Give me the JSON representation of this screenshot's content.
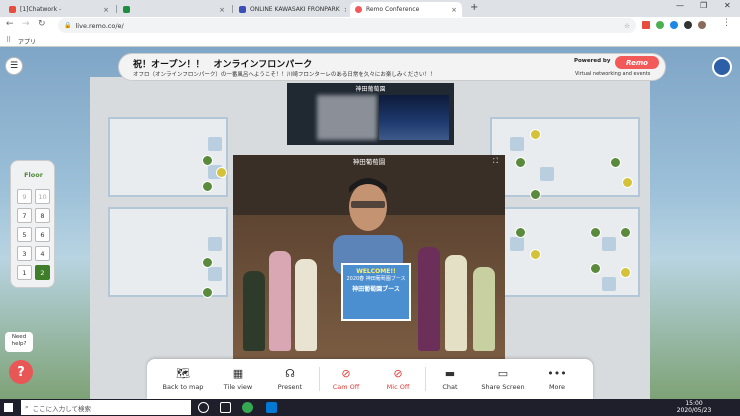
{
  "browser": {
    "tabs": [
      {
        "title": "[1]Chatwork -",
        "active": false,
        "color": "#e74c3c"
      },
      {
        "title": "",
        "active": false,
        "color": "#1e8e3e"
      },
      {
        "title": "ONLINE KAWASAKI FRONPARK",
        "active": false,
        "color": "#3b4fb8"
      },
      {
        "title": "Remo Conference",
        "active": true,
        "color": "#f25a5a"
      }
    ],
    "url": "live.remo.co/e/",
    "bookmarks_label": "アプリ"
  },
  "banner": {
    "title": "祝！オープン！！　オンラインフロンパーク",
    "subtitle": "オフロ（オンラインフロンパーク）の一番風呂へようこそ！！川崎フロンターレのある日常を久々にお楽しみください！！",
    "powered_by": "Powered by",
    "logo": "Remo",
    "tagline": "Virtual networking and events"
  },
  "floor": {
    "label": "Floor",
    "buttons": [
      "9",
      "10",
      "7",
      "8",
      "5",
      "6",
      "3",
      "4",
      "1",
      "2"
    ],
    "selected": "2"
  },
  "videos": {
    "small_label": "神田葡萄園",
    "main_label": "神田葡萄園",
    "sign_title": "WELCOME!!",
    "sign_line": "2020春 神田葡萄園ブース",
    "sign_name": "神田葡萄園ブース"
  },
  "controls": [
    {
      "label": "Back to map",
      "icon": "map-icon"
    },
    {
      "label": "Tile view",
      "icon": "grid-icon"
    },
    {
      "label": "Present",
      "icon": "present-icon"
    },
    {
      "label": "Cam Off",
      "icon": "camera-off-icon"
    },
    {
      "label": "Mic Off",
      "icon": "mic-off-icon"
    },
    {
      "label": "Chat",
      "icon": "chat-icon"
    },
    {
      "label": "Share Screen",
      "icon": "screen-icon"
    },
    {
      "label": "More",
      "icon": "more-icon"
    }
  ],
  "help": {
    "text_1": "Need",
    "text_2": "help?",
    "icon": "?"
  },
  "taskbar": {
    "search_placeholder": "ここに入力して検索",
    "time": "15:00",
    "date": "2020/05/23"
  },
  "colors": {
    "remo_red": "#f25a5a",
    "floor_green": "#3e7d2a",
    "cam_red": "#e53935"
  }
}
